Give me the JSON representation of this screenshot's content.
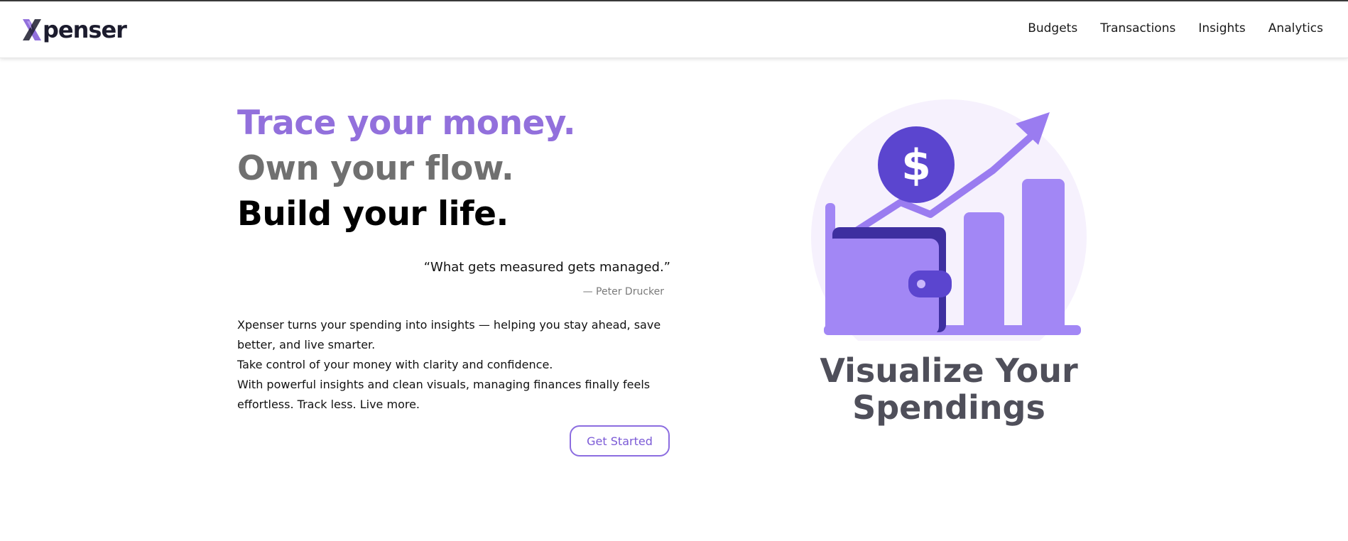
{
  "brand": {
    "name": "Xpenser",
    "logo_rest": "penser",
    "accent": "#9270dc"
  },
  "nav": {
    "items": [
      "Budgets",
      "Transactions",
      "Insights",
      "Analytics"
    ]
  },
  "hero": {
    "line1": "Trace your money.",
    "line2": "Own your flow.",
    "line3": "Build your life.",
    "line_colors": [
      "#9270dc",
      "#707070",
      "#000000"
    ],
    "quote": "“What gets measured gets managed.”",
    "quote_author": "— Peter Drucker",
    "description": [
      "Xpenser turns your spending into insights — helping you stay ahead, save better, and live smarter.",
      "Take control of your money with clarity and confidence.",
      "With powerful insights and clean visuals, managing finances finally feels effortless. Track less. Live more."
    ],
    "cta_label": "Get Started"
  },
  "illustration": {
    "icons": [
      "dollar-coin-icon",
      "trend-arrow-icon",
      "wallet-icon",
      "bar-chart-icon"
    ],
    "title_line1": "Visualize Your",
    "title_line2": "Spendings",
    "colors": {
      "circle_bg": "#f5f0fd",
      "coin": "#5b45cf",
      "bars": "#a287f5",
      "wallet_dark": "#3e2fa0",
      "arrow": "#9a7cf0"
    }
  }
}
